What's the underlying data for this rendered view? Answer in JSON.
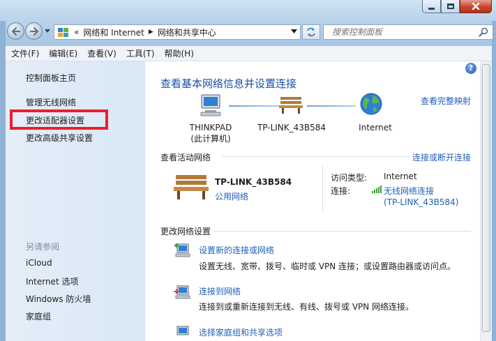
{
  "address": {
    "overflow": "«",
    "crumbs": [
      "网络和 Internet",
      "网络和共享中心"
    ]
  },
  "search": {
    "placeholder": "搜索控制面板"
  },
  "menu": [
    "文件(F)",
    "编辑(E)",
    "查看(V)",
    "工具(T)",
    "帮助(H)"
  ],
  "sidebar": {
    "home": "控制面板主页",
    "items": [
      "管理无线网络",
      "更改适配器设置",
      "更改高级共享设置"
    ],
    "see_also_heading": "另请参阅",
    "see_also": [
      "iCloud",
      "Internet 选项",
      "Windows 防火墙",
      "家庭组"
    ]
  },
  "main": {
    "help": "?",
    "title": "查看基本网络信息并设置连接",
    "full_map": "查看完整映射",
    "map": {
      "computer": {
        "line1": "THINKPAD",
        "line2": "(此计算机)"
      },
      "router": "TP-LINK_43B584",
      "internet": "Internet"
    },
    "active": {
      "heading": "查看活动网络",
      "connect_link": "连接或断开连接",
      "network_name": "TP-LINK_43B584",
      "network_type": "公用网络",
      "access_label": "访问类型:",
      "access_value": "Internet",
      "conn_label": "连接:",
      "conn_value_1": "无线网络连接",
      "conn_value_2": "(TP-LINK_43B584)"
    },
    "change": {
      "heading": "更改网络设置",
      "tasks": [
        {
          "title": "设置新的连接或网络",
          "desc": "设置无线、宽带、拨号、临时或 VPN 连接；或设置路由器或访问点。"
        },
        {
          "title": "连接到网络",
          "desc": "连接到或重新连接到无线、有线、拨号或 VPN 网络连接。"
        },
        {
          "title": "选择家庭组和共享选项",
          "desc": ""
        }
      ]
    }
  },
  "colors": {
    "link": "#1f5fb8",
    "title": "#1b4fa3",
    "highlight": "#f01c2c",
    "sidebar_bg": "#dbe8f6"
  }
}
